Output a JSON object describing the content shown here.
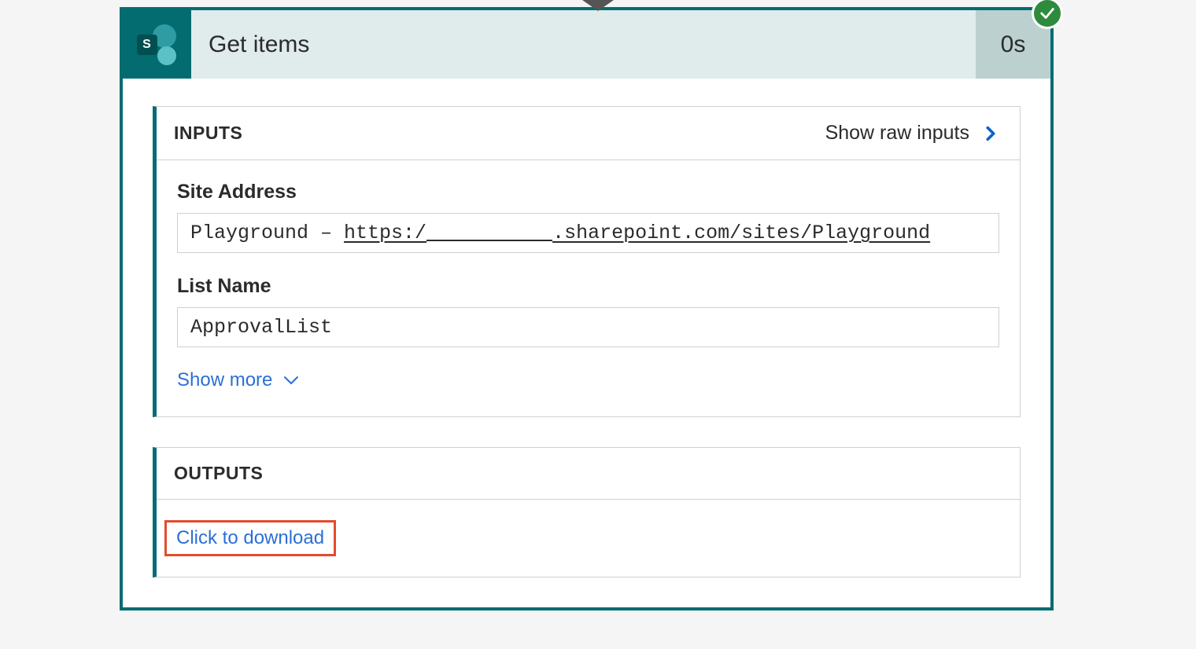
{
  "header": {
    "icon_letter": "S",
    "title": "Get items",
    "duration": "0s"
  },
  "inputs": {
    "section_label": "INPUTS",
    "show_raw_label": "Show raw inputs",
    "fields": {
      "site_address": {
        "label": "Site Address",
        "value_prefix": "Playground – ",
        "value_url_scheme": "https:/",
        "value_url_remainder": ".sharepoint.com/sites/Playground"
      },
      "list_name": {
        "label": "List Name",
        "value": "ApprovalList"
      }
    },
    "show_more_label": "Show more"
  },
  "outputs": {
    "section_label": "OUTPUTS",
    "download_label": "Click to download"
  }
}
